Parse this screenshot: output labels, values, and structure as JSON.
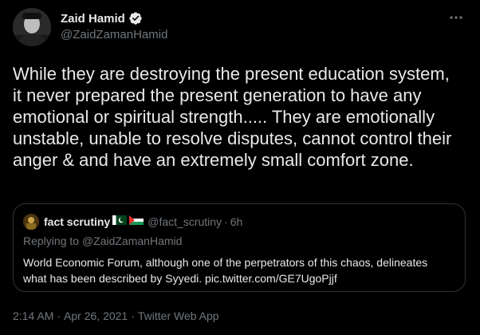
{
  "author": {
    "display_name": "Zaid Hamid",
    "handle": "@ZaidZamanHamid",
    "verified_icon": "verified-badge-icon"
  },
  "tweet": {
    "text": "While they are destroying the present education system, it never prepared the present generation to have any emotional or spiritual strength..... They are emotionally unstable, unable to resolve disputes, cannot control their anger & and have an extremely small comfort zone."
  },
  "quote": {
    "display_name": "fact scrutiny",
    "flags": [
      "pakistan-flag-icon",
      "palestine-flag-icon"
    ],
    "handle": "@fact_scrutiny",
    "separator": "·",
    "time": "6h",
    "replying_prefix": "Replying to ",
    "replying_handle": "@ZaidZamanHamid",
    "text": "World Economic Forum, although one of the perpetrators of this chaos, delineates what has been described by Syyedi. pic.twitter.com/GE7UgoPjjf"
  },
  "meta": {
    "time": "2:14 AM",
    "date": "Apr 26, 2021",
    "source": "Twitter Web App",
    "separator": "·"
  },
  "colors": {
    "background": "#000000",
    "text_primary": "#e7e9ea",
    "text_secondary": "#71767b",
    "border": "#2f3336",
    "verified": "#1d9bf0"
  }
}
